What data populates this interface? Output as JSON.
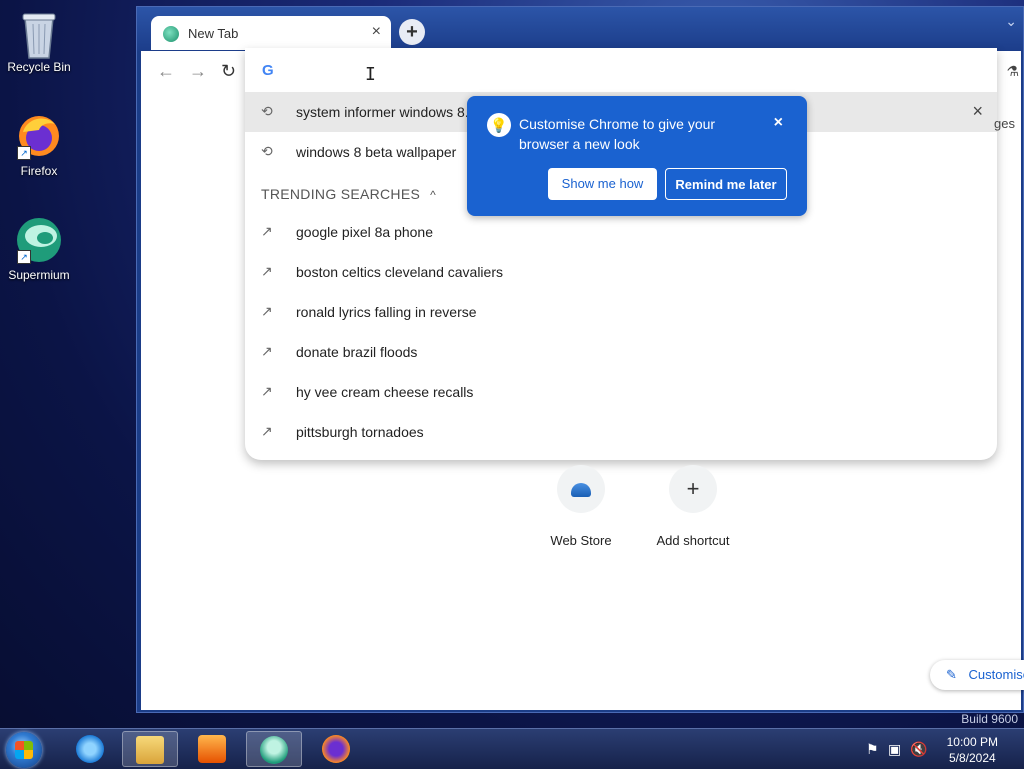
{
  "desktop": {
    "icons": [
      {
        "label": "Recycle Bin",
        "icon": "recycle-bin-icon"
      },
      {
        "label": "Firefox",
        "icon": "firefox-icon"
      },
      {
        "label": "Supermium",
        "icon": "supermium-icon"
      }
    ],
    "build_text": "Build 9600"
  },
  "browser": {
    "tab": {
      "title": "New Tab",
      "close": "×"
    },
    "new_tab": "+",
    "nav": {
      "back": "←",
      "forward": "→",
      "reload": "↻"
    },
    "omnibox": {
      "engine_logo": "G",
      "history": [
        {
          "text": "system informer windows 8.",
          "icon": "history-icon",
          "remove": "×"
        },
        {
          "text": "windows 8 beta wallpaper",
          "icon": "history-icon"
        }
      ],
      "trending_heading": "TRENDING SEARCHES",
      "trending": [
        "google pixel 8a phone",
        "boston celtics cleveland cavaliers",
        "ronald lyrics falling in reverse",
        "donate brazil floods",
        "hy vee cream cheese recalls",
        "pittsburgh tornadoes"
      ]
    },
    "promo": {
      "message": "Customise Chrome to give your browser a new look",
      "primary_button": "Show me how",
      "secondary_button": "Remind me later",
      "close": "×"
    },
    "partial_text": "ges",
    "shortcuts": [
      {
        "label": "Web Store"
      },
      {
        "label": "Add shortcut",
        "glyph": "+"
      }
    ],
    "customise_button": "Customise"
  },
  "taskbar": {
    "time": "10:00 PM",
    "date": "5/8/2024"
  },
  "colors": {
    "promo_blue": "#1a62d0",
    "taskbar": "#1e2d5c"
  }
}
